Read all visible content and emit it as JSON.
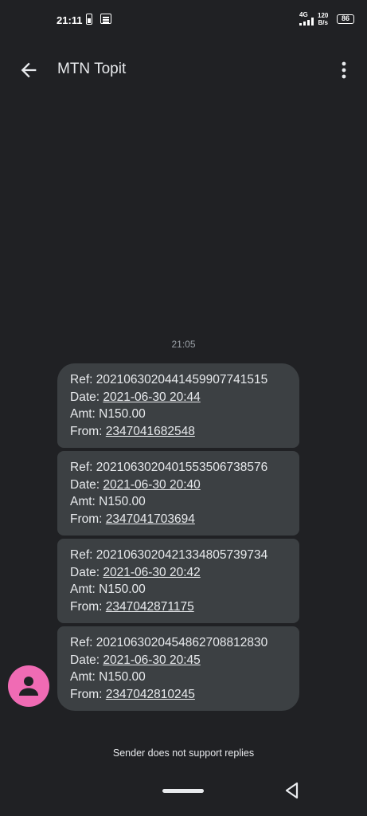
{
  "status_bar": {
    "time": "21:11",
    "network": "4G",
    "speed_value": "120",
    "speed_unit": "B/s",
    "battery": "86"
  },
  "app_bar": {
    "title": "MTN Topit",
    "back_icon": "arrow-left-icon",
    "menu_icon": "more-vert-icon"
  },
  "conversation": {
    "timestamp": "21:05",
    "messages": [
      {
        "ref_label": "Ref: ",
        "ref": "20210630204414599077415​15",
        "date_label": "Date: ",
        "date": "2021-06-30 20:44",
        "amt": "Amt: N150.00",
        "from_label": "From: ",
        "from": "2347041682548"
      },
      {
        "ref_label": "Ref: ",
        "ref": "20210630204015535067385​76",
        "date_label": "Date: ",
        "date": "2021-06-30 20:40",
        "amt": "Amt: N150.00",
        "from_label": "From: ",
        "from": "2347041703694"
      },
      {
        "ref_label": "Ref: ",
        "ref": "20210630204213348057397​34",
        "date_label": "Date: ",
        "date": "2021-06-30 20:42",
        "amt": "Amt: N150.00",
        "from_label": "From: ",
        "from": "2347042871175"
      },
      {
        "ref_label": "Ref: ",
        "ref": "20210630204548627088128​30",
        "date_label": "Date: ",
        "date": "2021-06-30 20:45",
        "amt": "Amt: N150.00",
        "from_label": "From: ",
        "from": "2347042810245"
      }
    ],
    "footer_note": "Sender does not support replies"
  },
  "colors": {
    "background": "#202124",
    "bubble": "#3c4043",
    "avatar": "#f06bb4"
  }
}
